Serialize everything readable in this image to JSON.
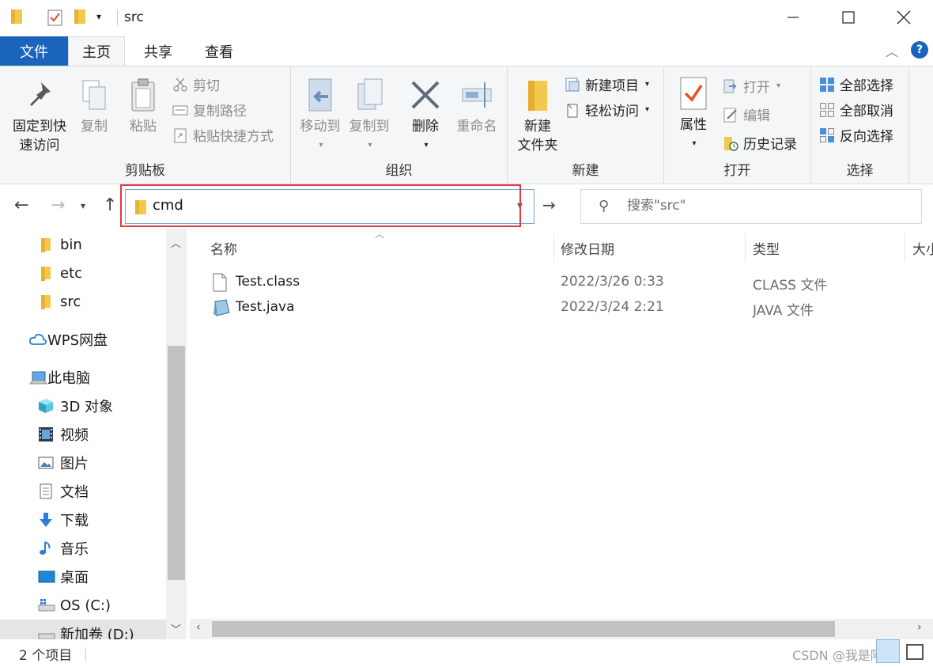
{
  "titlebar": {
    "title": "src"
  },
  "tabs": {
    "file": "文件",
    "home": "主页",
    "share": "共享",
    "view": "查看"
  },
  "ribbon": {
    "clipboard": {
      "label": "剪贴板",
      "pin_line1": "固定到快",
      "pin_line2": "速访问",
      "copy": "复制",
      "paste": "粘贴",
      "cut": "剪切",
      "copy_path": "复制路径",
      "paste_shortcut": "粘贴快捷方式"
    },
    "organize": {
      "label": "组织",
      "move_to": "移动到",
      "copy_to": "复制到",
      "delete": "删除",
      "rename": "重命名"
    },
    "new": {
      "label": "新建",
      "new_folder_line1": "新建",
      "new_folder_line2": "文件夹",
      "new_item": "新建项目",
      "easy_access": "轻松访问"
    },
    "open": {
      "label": "打开",
      "properties": "属性",
      "open": "打开",
      "edit": "编辑",
      "history": "历史记录"
    },
    "select": {
      "label": "选择",
      "select_all": "全部选择",
      "select_none": "全部取消",
      "invert": "反向选择"
    }
  },
  "address": {
    "value": "cmd"
  },
  "search": {
    "placeholder": "搜索\"src\""
  },
  "nav": {
    "items": [
      {
        "label": "bin"
      },
      {
        "label": "etc"
      },
      {
        "label": "src"
      },
      {
        "label": "WPS网盘"
      },
      {
        "label": "此电脑"
      },
      {
        "label": "3D 对象"
      },
      {
        "label": "视频"
      },
      {
        "label": "图片"
      },
      {
        "label": "文档"
      },
      {
        "label": "下载"
      },
      {
        "label": "音乐"
      },
      {
        "label": "桌面"
      },
      {
        "label": "OS (C:)"
      },
      {
        "label": "新加卷 (D:)"
      }
    ]
  },
  "columns": {
    "name": "名称",
    "modified": "修改日期",
    "type": "类型",
    "size": "大小"
  },
  "files": [
    {
      "name": "Test.class",
      "modified": "2022/3/26 0:33",
      "type": "CLASS 文件"
    },
    {
      "name": "Test.java",
      "modified": "2022/3/24 2:21",
      "type": "JAVA 文件"
    }
  ],
  "status": {
    "count": "2 个项目",
    "watermark": "CSDN @我是阿黑"
  },
  "colors": {
    "accent": "#1a64bd",
    "highlight_box": "#e0393e",
    "folder": "#f2c94c"
  }
}
